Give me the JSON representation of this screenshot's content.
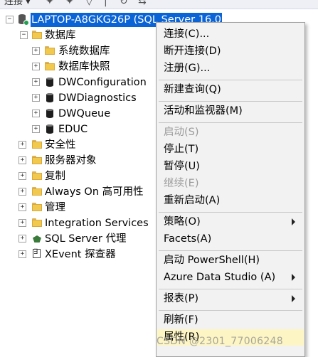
{
  "toolbar": {
    "connect_label": "连接 ▾"
  },
  "tree": {
    "server": "LAPTOP-A8GKG26P (SQL Server 16.0",
    "databases": "数据库",
    "system_databases": "系统数据库",
    "database_snapshots": "数据库快照",
    "db_dwconfiguration": "DWConfiguration",
    "db_dwdiagnostics": "DWDiagnostics",
    "db_dwqueue": "DWQueue",
    "db_educ": "EDUC",
    "security": "安全性",
    "server_objects": "服务器对象",
    "replication": "复制",
    "always_on": "Always On 高可用性",
    "management": "管理",
    "integration_services": "Integration Services",
    "sql_agent": "SQL Server 代理",
    "xevent_profiler": "XEvent 探查器",
    "expand_glyph": "+",
    "collapse_glyph": "−"
  },
  "context_menu": {
    "connect": "连接(C)...",
    "disconnect": "断开连接(D)",
    "register": "注册(G)...",
    "new_query": "新建查询(Q)",
    "activity_monitor": "活动和监视器(M)",
    "start": "启动(S)",
    "stop": "停止(T)",
    "pause": "暂停(U)",
    "resume": "继续(E)",
    "restart": "重新启动(A)",
    "policies": "策略(O)",
    "facets": "Facets(A)",
    "start_powershell": "启动 PowerShell(H)",
    "azure_data_studio": "Azure Data Studio (A)",
    "reports": "报表(P)",
    "refresh": "刷新(F)",
    "properties": "属性(R)"
  },
  "watermark": "CSDN @2301_77006248",
  "colors": {
    "selection": "#0a64d6",
    "menu_bg": "#f2f2f2",
    "hover": "#fdf5c4",
    "folder": "#f1c94f"
  }
}
